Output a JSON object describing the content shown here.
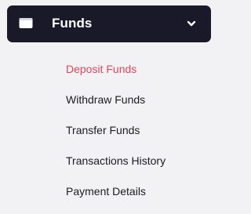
{
  "header": {
    "icon": "wallet-icon",
    "label": "Funds",
    "toggle_icon": "chevron-down-icon",
    "background_color": "#19192a"
  },
  "submenu": {
    "active_color": "#e0465c",
    "items": [
      {
        "label": "Deposit Funds",
        "active": true
      },
      {
        "label": "Withdraw Funds",
        "active": false
      },
      {
        "label": "Transfer Funds",
        "active": false
      },
      {
        "label": "Transactions History",
        "active": false
      },
      {
        "label": "Payment Details",
        "active": false
      }
    ]
  }
}
